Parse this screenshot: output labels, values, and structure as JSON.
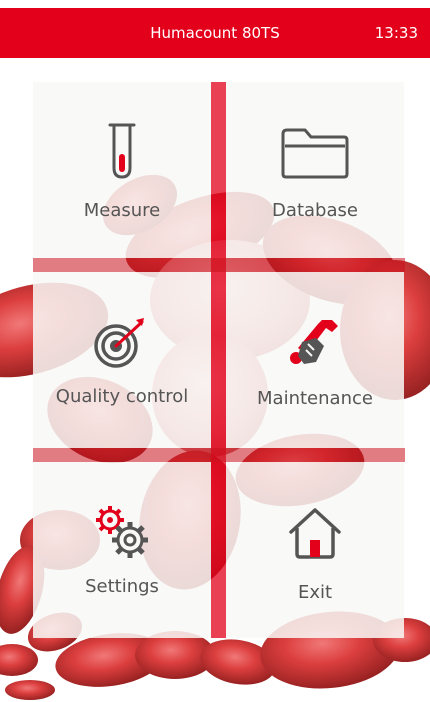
{
  "app": {
    "title": "Humacount 80TS",
    "time": "13:33"
  },
  "colors": {
    "accent": "#e3001b",
    "tile": "#f8f8f6",
    "text": "#555555",
    "icon": "#555555"
  },
  "menu": {
    "items": [
      {
        "id": "measure",
        "label": "Measure",
        "icon": "test-tube-icon"
      },
      {
        "id": "database",
        "label": "Database",
        "icon": "folder-icon"
      },
      {
        "id": "quality_control",
        "label": "Quality control",
        "icon": "target-icon"
      },
      {
        "id": "maintenance",
        "label": "Maintenance",
        "icon": "wrench-hand-icon"
      },
      {
        "id": "settings",
        "label": "Settings",
        "icon": "gears-icon"
      },
      {
        "id": "exit",
        "label": "Exit",
        "icon": "home-icon"
      }
    ]
  }
}
